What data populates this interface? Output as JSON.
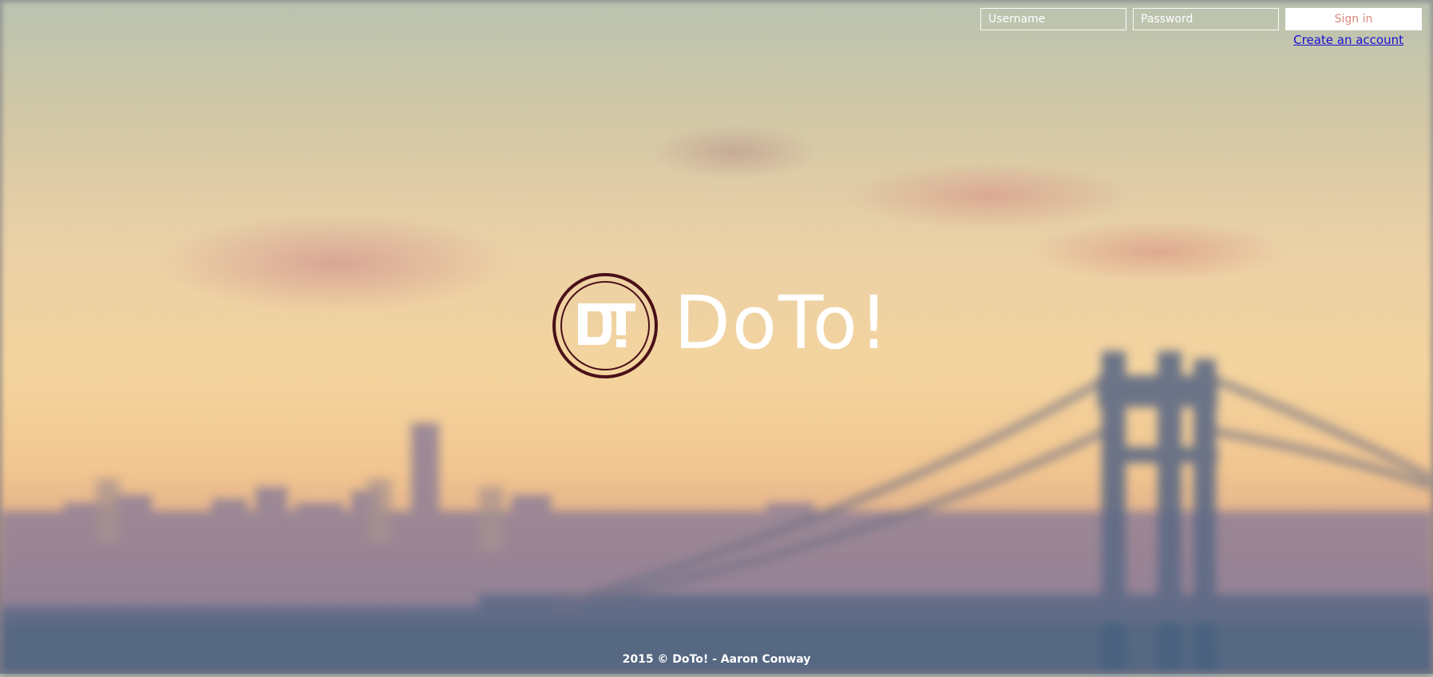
{
  "login": {
    "username_placeholder": "Username",
    "password_placeholder": "Password",
    "signin_label": "Sign in",
    "create_account_label": "Create an account"
  },
  "brand": {
    "logo_letters": "DT",
    "name": "DoTo!"
  },
  "footer": {
    "text": "2015 © DoTo! - Aaron Conway"
  },
  "colors": {
    "accent": "#d88a7a",
    "logo_ring": "#4a1018",
    "link": "#1a0dd4"
  },
  "background": {
    "description_icon": "blurred-city-bridge-photo"
  }
}
